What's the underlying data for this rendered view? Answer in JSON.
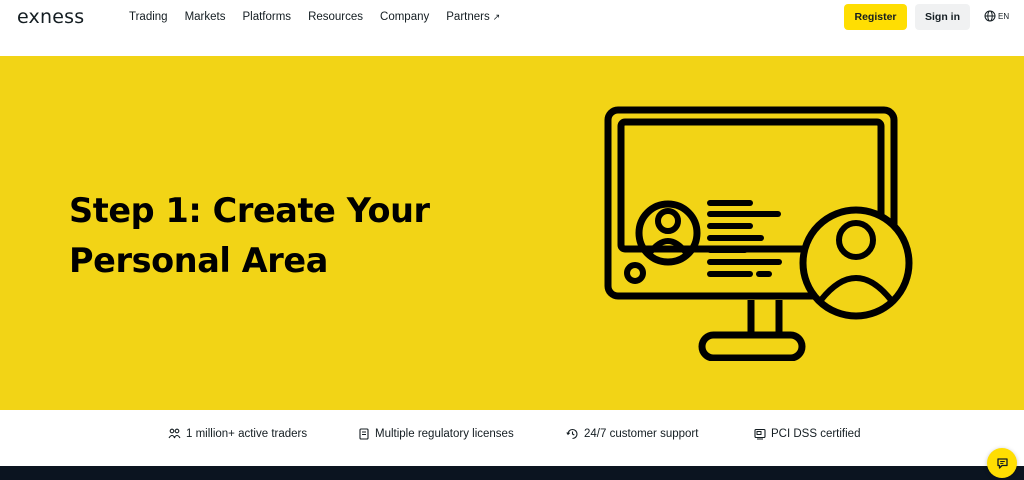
{
  "header": {
    "logo": "exness",
    "nav": [
      {
        "label": "Trading"
      },
      {
        "label": "Markets"
      },
      {
        "label": "Platforms"
      },
      {
        "label": "Resources"
      },
      {
        "label": "Company"
      },
      {
        "label": "Partners",
        "icon": "external-arrow-icon"
      }
    ],
    "register_label": "Register",
    "signin_label": "Sign in",
    "language": {
      "icon": "globe-icon",
      "label": "EN"
    }
  },
  "hero": {
    "title": "Step 1: Create Your Personal Area",
    "illustration_icon": "computer-user-profile-icon"
  },
  "stats": [
    {
      "icon": "users-icon",
      "label": "1 million+ active traders"
    },
    {
      "icon": "license-document-icon",
      "label": "Multiple regulatory licenses"
    },
    {
      "icon": "support-clock-icon",
      "label": "24/7 customer support"
    },
    {
      "icon": "certified-card-icon",
      "label": "PCI DSS certified"
    }
  ],
  "chat": {
    "icon": "chat-bubble-icon"
  },
  "colors": {
    "brand_yellow": "#ffde02",
    "hero_background": "#f2d416",
    "dark": "#141d22"
  }
}
